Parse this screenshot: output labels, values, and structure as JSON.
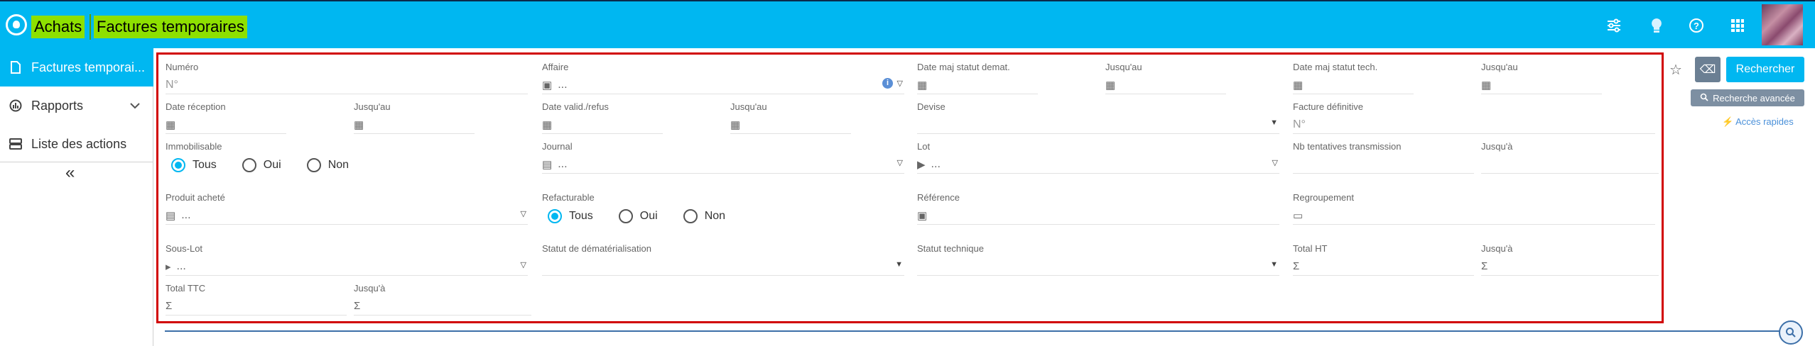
{
  "header": {
    "breadcrumb": [
      "Achats",
      "Factures temporaires"
    ],
    "icons": [
      "sliders-icon",
      "lightbulb-icon",
      "help-icon",
      "apps-grid-icon"
    ],
    "accent": "#00b7f1",
    "highlight": "#8ee000"
  },
  "sidebar": {
    "items": [
      {
        "label": "Factures temporai...",
        "icon": "invoice-icon",
        "active": true
      },
      {
        "label": "Rapports",
        "icon": "report-icon",
        "expandable": true
      },
      {
        "label": "Liste des actions",
        "icon": "list-icon"
      }
    ],
    "collapse": "«"
  },
  "form": {
    "numero": {
      "label": "Numéro",
      "placeholder": "N°"
    },
    "affaire": {
      "label": "Affaire",
      "value": "..."
    },
    "date_maj_statut_demat": {
      "label": "Date maj statut demat."
    },
    "jusqu_au_1": {
      "label": "Jusqu'au"
    },
    "date_maj_statut_tech": {
      "label": "Date maj statut tech."
    },
    "jusqu_au_2": {
      "label": "Jusqu'au"
    },
    "date_reception": {
      "label": "Date réception"
    },
    "jusqu_au_3": {
      "label": "Jusqu'au"
    },
    "date_valid_refus": {
      "label": "Date valid./refus"
    },
    "jusqu_au_4": {
      "label": "Jusqu'au"
    },
    "devise": {
      "label": "Devise"
    },
    "facture_definitive": {
      "label": "Facture définitive",
      "placeholder": "N°"
    },
    "immobilisable": {
      "label": "Immobilisable",
      "options": [
        "Tous",
        "Oui",
        "Non"
      ],
      "selected": "Tous"
    },
    "journal": {
      "label": "Journal",
      "value": "..."
    },
    "lot": {
      "label": "Lot",
      "value": "..."
    },
    "nb_tentatives": {
      "label": "Nb tentatives transmission"
    },
    "jusqu_a_1": {
      "label": "Jusqu'à"
    },
    "produit_achete": {
      "label": "Produit acheté",
      "value": "..."
    },
    "refacturable": {
      "label": "Refacturable",
      "options": [
        "Tous",
        "Oui",
        "Non"
      ],
      "selected": "Tous"
    },
    "reference": {
      "label": "Référence"
    },
    "regroupement": {
      "label": "Regroupement"
    },
    "sous_lot": {
      "label": "Sous-Lot",
      "value": "..."
    },
    "statut_demat": {
      "label": "Statut de dématérialisation"
    },
    "statut_technique": {
      "label": "Statut technique"
    },
    "total_ht": {
      "label": "Total HT"
    },
    "jusqu_a_2": {
      "label": "Jusqu'à"
    },
    "total_ttc": {
      "label": "Total TTC"
    },
    "jusqu_a_3": {
      "label": "Jusqu'à"
    }
  },
  "actions": {
    "search": "Rechercher",
    "advanced": "Recherche avancée",
    "quick": "Accès rapides"
  }
}
